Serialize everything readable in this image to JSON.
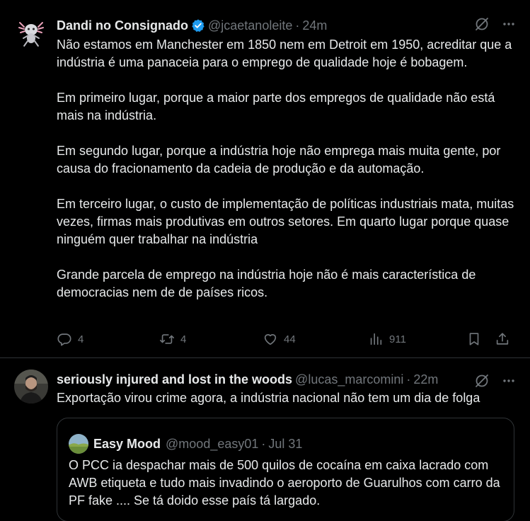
{
  "tweets": [
    {
      "name": "Dandi no Consignado",
      "handle": "@jcaetanoleite",
      "time": "24m",
      "paragraphs": [
        "Não estamos em Manchester em 1850 nem em Detroit em 1950, acreditar que a indústria é uma panaceia para o emprego de qualidade hoje é bobagem.",
        "Em primeiro lugar, porque a maior parte dos empregos de qualidade não está mais na indústria.",
        "Em segundo lugar, porque a indústria hoje não emprega mais muita gente, por causa do fracionamento da cadeia de produção e da automação.",
        "Em terceiro lugar, o custo de implementação de políticas industriais mata, muitas vezes, firmas mais produtivas em outros setores. Em quarto lugar porque quase ninguém quer trabalhar na indústria",
        "Grande parcela de emprego na indústria hoje não é mais característica de democracias nem de de países ricos."
      ],
      "replies": "4",
      "retweets": "4",
      "likes": "44",
      "views": "911"
    },
    {
      "name": "seriously injured and lost in the woods",
      "handle": "@lucas_marcomini",
      "time": "22m",
      "text": "Exportação virou crime agora, a indústria nacional não tem um dia de folga",
      "quote": {
        "name": "Easy Mood",
        "handle": "@mood_easy01",
        "time": "Jul 31",
        "text": "O PCC ia despachar mais de 500 quilos de cocaína em caixa lacrado com AWB etiqueta e tudo mais invadindo o aeroporto de Guarulhos com carro da PF fake .... Se tá doido esse país tá largado."
      }
    }
  ],
  "separator": "·",
  "colors": {
    "background": "#000000",
    "text": "#e7e9ea",
    "secondary": "#71767b",
    "verified": "#1d9bf0",
    "border": "#2f3336"
  }
}
